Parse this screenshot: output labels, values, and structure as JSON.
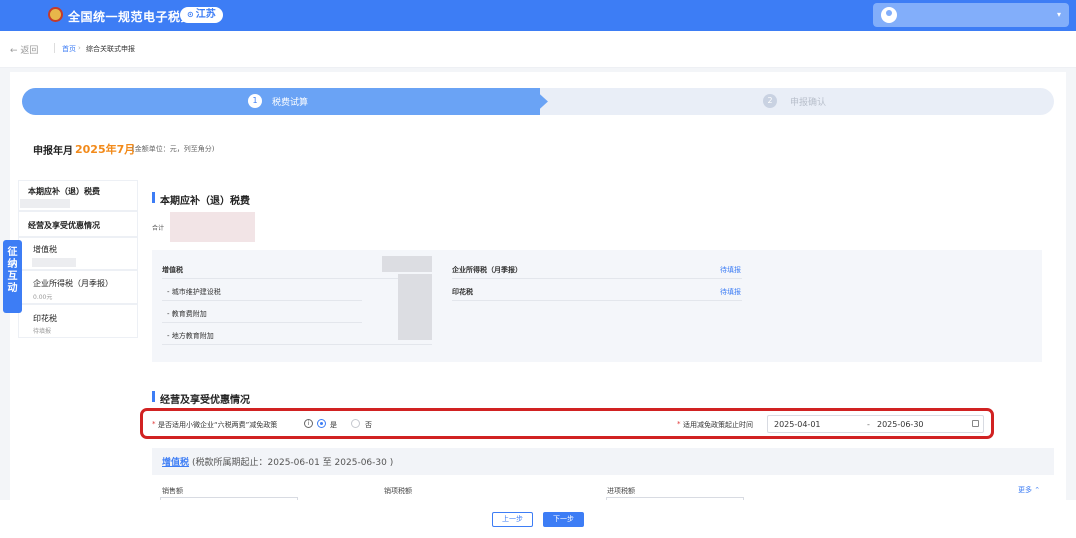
{
  "header": {
    "site_title": "全国统一规范电子税务局",
    "region": "江苏",
    "region_icon": "location-pin-icon",
    "user_icon": "user-avatar-icon",
    "dropdown_icon": "caret-down-icon"
  },
  "breadcrumb": {
    "back": "← 返回",
    "home": "首页",
    "separator": "›",
    "current": "综合关联式申报"
  },
  "steps": [
    {
      "number": "1",
      "label": "税费试算",
      "active": true
    },
    {
      "number": "2",
      "label": "申报确认",
      "active": false
    }
  ],
  "period": {
    "label": "申报年月",
    "value": "2025年7月",
    "note": "(金额单位：元，列至角分)"
  },
  "left_nav": {
    "items": [
      {
        "label": "本期应补（退）税费"
      },
      {
        "label": "经营及享受优惠情况"
      },
      {
        "label": "增值税"
      },
      {
        "label": "企业所得税（月季报）",
        "sub": "0.00元"
      },
      {
        "label": "印花税",
        "sub": "待填报"
      }
    ],
    "interaction_tab": [
      "征",
      "纳",
      "互",
      "动"
    ]
  },
  "section_due": {
    "title": "本期应补（退）税费",
    "total_label": "合计"
  },
  "tax_panel": {
    "left": [
      {
        "label": "增值税"
      },
      {
        "label": "- 城市维护建设税"
      },
      {
        "label": "- 教育费附加"
      },
      {
        "label": "- 地方教育附加"
      }
    ],
    "right": [
      {
        "label": "企业所得税（月季报）",
        "status": "待填报"
      },
      {
        "label": "印花税",
        "status": "待填报"
      }
    ]
  },
  "section_business": {
    "title": "经营及享受优惠情况",
    "question": "是否适用小微企业“六税两费”减免政策",
    "info_icon": "info-icon",
    "options": [
      {
        "label": "是",
        "selected": true
      },
      {
        "label": "否",
        "selected": false
      }
    ],
    "date_label": "适用减免政策起止时间",
    "date_start": "2025-04-01",
    "date_sep": "-",
    "date_end": "2025-06-30",
    "calendar_icon": "calendar-icon",
    "required_mark": "*"
  },
  "vat_section": {
    "link": "增值税",
    "note": "(税款所属期起止：2025-06-01 至 2025-06-30 )",
    "columns": [
      "销售额",
      "销项税额",
      "进项税额"
    ],
    "more": "更多 ⌃"
  },
  "footer": {
    "prev": "上一步",
    "next": "下一步"
  },
  "colors": {
    "primary": "#3d7df5",
    "accent": "#f28a1a",
    "highlight": "#d12222"
  }
}
